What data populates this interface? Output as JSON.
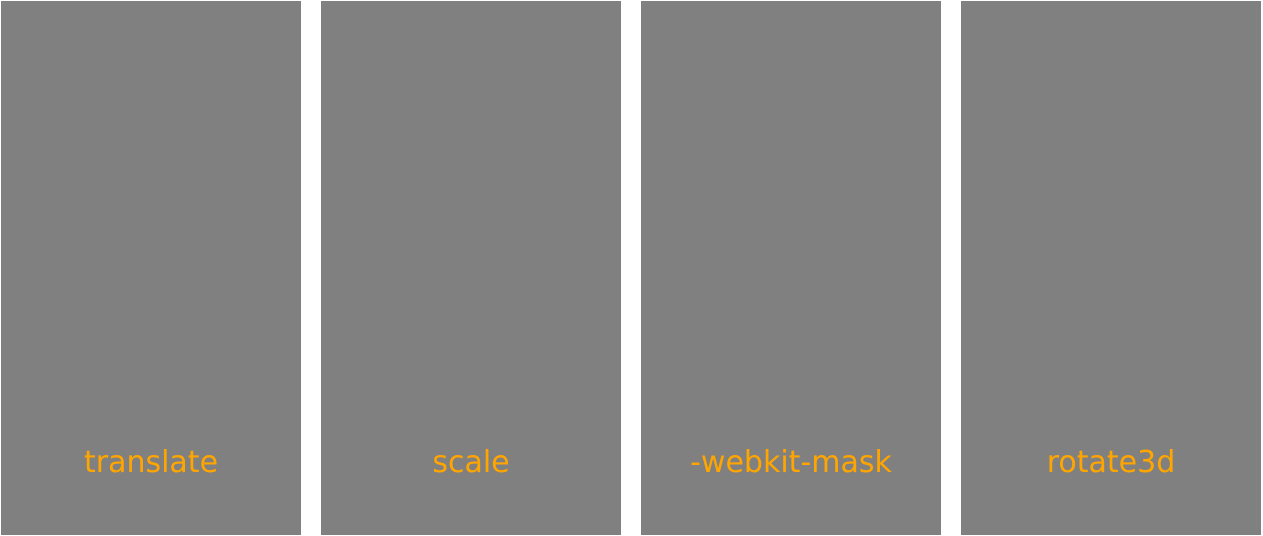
{
  "cards": [
    {
      "label": "translate"
    },
    {
      "label": "scale"
    },
    {
      "label": "-webkit-mask"
    },
    {
      "label": "rotate3d"
    }
  ],
  "colors": {
    "card_background": "#808080",
    "label_text": "#ffa500",
    "page_background": "#ffffff"
  }
}
